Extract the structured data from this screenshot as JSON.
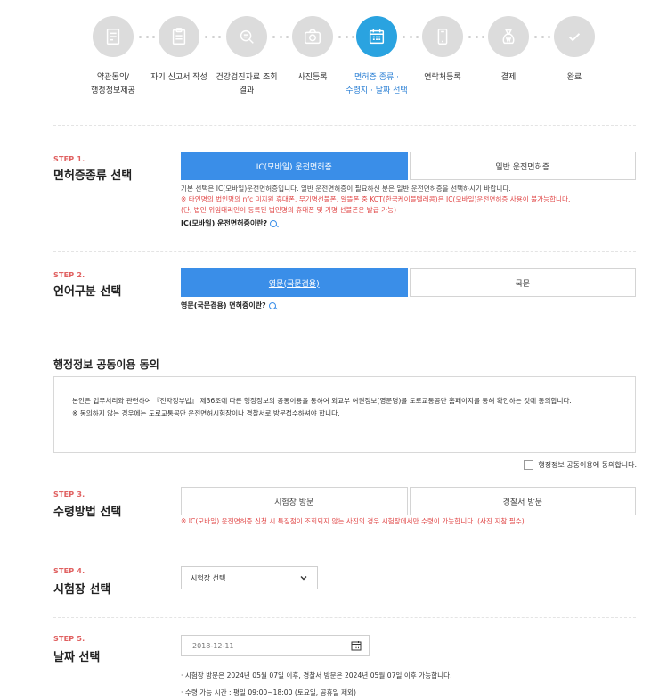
{
  "steps": [
    {
      "label": "약관동의/\n행정정보제공",
      "icon": "document-check-icon",
      "active": false
    },
    {
      "label": "자기 신고서 작성",
      "icon": "clipboard-icon",
      "active": false
    },
    {
      "label": "건강검진자료 조회\n결과",
      "icon": "search-document-icon",
      "active": false
    },
    {
      "label": "사진등록",
      "icon": "camera-icon",
      "active": false
    },
    {
      "label": "면허증 종류 ·\n수령지 · 날짜 선택",
      "icon": "calendar-icon",
      "active": true
    },
    {
      "label": "연락처등록",
      "icon": "phone-icon",
      "active": false
    },
    {
      "label": "결제",
      "icon": "money-bag-icon",
      "active": false
    },
    {
      "label": "완료",
      "icon": "check-icon",
      "active": false
    }
  ],
  "colors": {
    "active_step": "#2aa3e0",
    "primary": "#3a8ee8",
    "step_tag": "#e06060",
    "warning": "#e04545",
    "inactive_step": "#dcdcdc"
  },
  "step1": {
    "tag": "STEP 1.",
    "title": "면허증종류 선택",
    "options": [
      "IC(모바일) 운전면허증",
      "일반 운전면허증"
    ],
    "selected": 0,
    "note": "기본 선택은 IC(모바일)운전면허증입니다. 일반 운전면허증이 필요하신 분은 일반 운전면허증을 선택하시기 바랍니다.",
    "warn1": "※ 타인명의 법인명의 nfc 미지원 휴대폰, 무기명선불폰, 알뜰폰 중 KCT(한국케이블텔레콤)은 IC(모바일)운전면허증 사용이 불가능합니다.",
    "warn2": "(단, 법인 위임대리인이 등록된 법인명의 휴대폰 및 기명 선불폰은 발급 가능)",
    "info_link": "IC(모바일) 운전면허증이란?"
  },
  "step2": {
    "tag": "STEP 2.",
    "title": "언어구분 선택",
    "options": [
      "영문(국문겸용)",
      "국문"
    ],
    "selected": 0,
    "info_link": "영문(국문겸용) 면허증이란?"
  },
  "consent": {
    "title": "행정정보 공동이용 동의",
    "text1": "본인은 업무처리와 관련하여 『전자정부법』 제36조에 따른 행정정보의 공동이용을 통하여 외교부 여권정보(영문명)를 도로교통공단 홈페이지를 통해 확인하는 것에 동의합니다.",
    "text2": "※ 동의하지 않는 경우에는 도로교통공단 운전면허시험장이나 경찰서로 방문접수하셔야 합니다.",
    "checkbox_label": "행정정보 공동이용에 동의합니다."
  },
  "step3": {
    "tag": "STEP 3.",
    "title": "수령방법 선택",
    "options": [
      "시험장 방문",
      "경찰서 방문"
    ],
    "warn": "※ IC(모바일) 운전면허증 신청 시 특징점이 조회되지 않는 사진의 경우 시험장에서만 수령이 가능합니다. (사진 지참 필수)"
  },
  "step4": {
    "tag": "STEP 4.",
    "title": "시험장 선택",
    "select_value": "시험장 선택"
  },
  "step5": {
    "tag": "STEP 5.",
    "title": "날짜 선택",
    "date_value": "2018-12-11",
    "bullet1": "· 시험장 방문은 2024년 05월 07일 이후, 경찰서 방문은 2024년 05월 07일 이후 가능합니다.",
    "bullet2": "· 수령 가능 시간 : 평일 09:00~18:00 (토요일, 공휴일 제외)"
  }
}
